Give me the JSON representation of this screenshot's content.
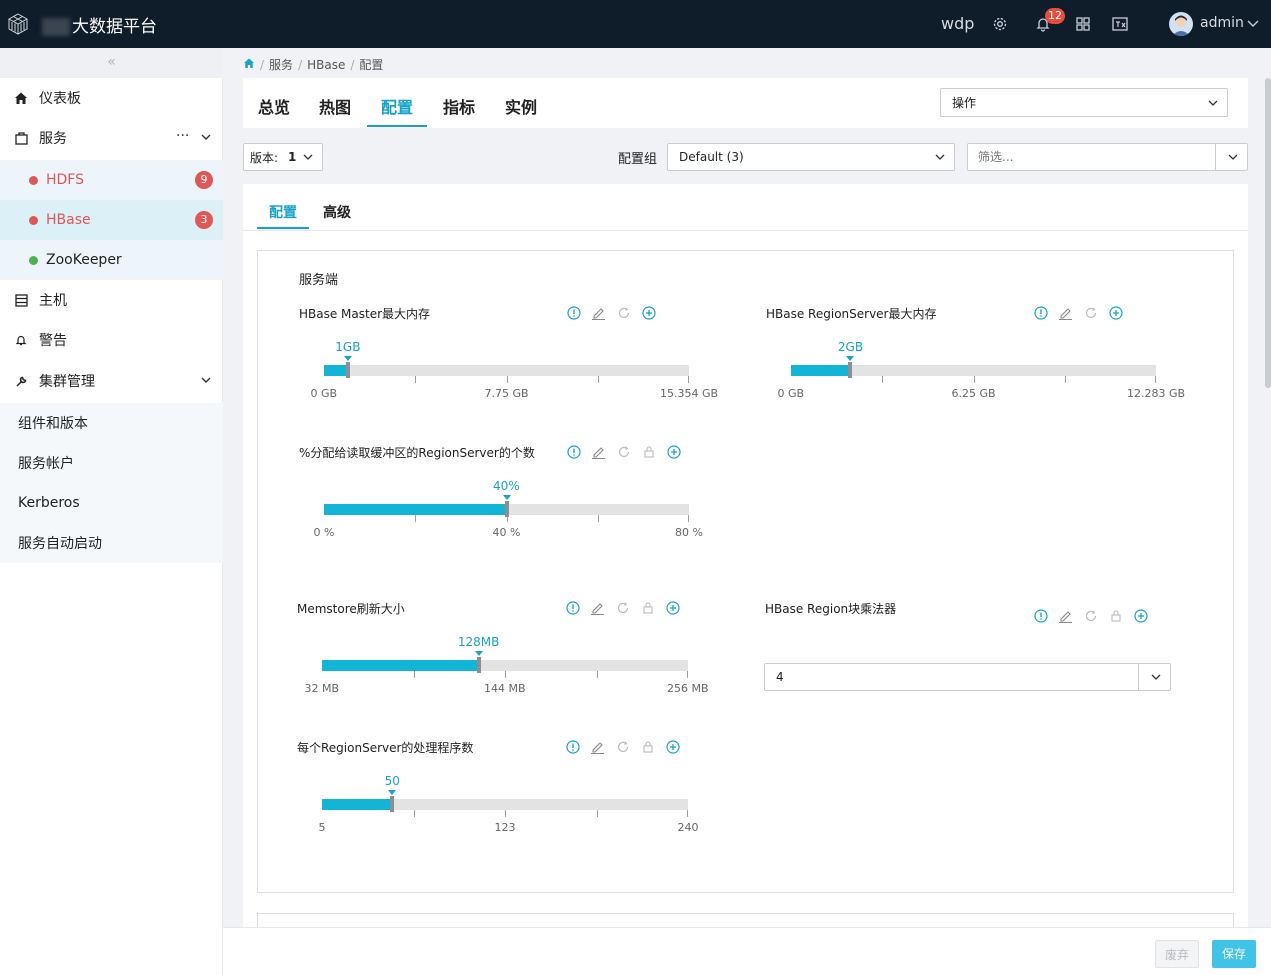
{
  "header": {
    "brand": "大数据平台",
    "brand_prefix": "",
    "user_short": "wdp",
    "notification_count": "12",
    "username": "admin"
  },
  "sidebar": {
    "collapse_label": "«",
    "items": [
      {
        "label": "仪表板"
      },
      {
        "label": "服务",
        "more": "···"
      },
      {
        "label": "主机"
      },
      {
        "label": "警告"
      },
      {
        "label": "集群管理"
      }
    ],
    "services": [
      {
        "label": "HDFS",
        "badge": "9",
        "color": "#e05757"
      },
      {
        "label": "HBase",
        "badge": "3",
        "color": "#e05757"
      },
      {
        "label": "ZooKeeper",
        "badge": "",
        "color": "#4caf50"
      }
    ],
    "cluster_items": [
      {
        "label": "组件和版本"
      },
      {
        "label": "服务帐户"
      },
      {
        "label": "Kerberos"
      },
      {
        "label": "服务自动启动"
      }
    ]
  },
  "breadcrumb": [
    "服务",
    "HBase",
    "配置"
  ],
  "tabs": [
    {
      "label": "总览"
    },
    {
      "label": "热图"
    },
    {
      "label": "配置",
      "active": true
    },
    {
      "label": "指标"
    },
    {
      "label": "实例"
    }
  ],
  "actions_select": "操作",
  "version": {
    "label": "版本:",
    "value": "1"
  },
  "config_group": {
    "label": "配置组",
    "value": "Default (3)"
  },
  "filter": {
    "placeholder": "筛选..."
  },
  "subtabs": [
    {
      "label": "配置",
      "active": true
    },
    {
      "label": "高级"
    }
  ],
  "section_title": "服务端",
  "fields": {
    "master_mem": {
      "label": "HBase Master最大内存",
      "value_label": "1GB",
      "value": 1,
      "min": 0,
      "max": 15.354,
      "axis": [
        "0 GB",
        "7.75 GB",
        "15.354 GB"
      ]
    },
    "rs_mem": {
      "label": "HBase RegionServer最大内存",
      "value_label": "2GB",
      "value": 2,
      "min": 0,
      "max": 12.283,
      "axis": [
        "0 GB",
        "6.25 GB",
        "12.283 GB"
      ]
    },
    "read_cache": {
      "label": "%分配给读取缓冲区的RegionServer的个数",
      "value_label": "40%",
      "value": 40,
      "min": 0,
      "max": 80,
      "axis": [
        "0 %",
        "40 %",
        "80 %"
      ]
    },
    "memstore": {
      "label": "Memstore刷新大小",
      "value_label": "128MB",
      "value": 128,
      "min": 32,
      "max": 256,
      "axis": [
        "32 MB",
        "144 MB",
        "256 MB"
      ]
    },
    "block_multiplier": {
      "label": "HBase Region块乘法器",
      "value": "4"
    },
    "handlers": {
      "label": "每个RegionServer的处理程序数",
      "value_label": "50",
      "value": 50,
      "min": 5,
      "max": 240,
      "axis": [
        "5",
        "123",
        "240"
      ]
    }
  },
  "footer": {
    "discard": "废弃",
    "save": "保存"
  },
  "colors": {
    "accent": "#17a2c8",
    "slider_fill": "#13b5d6",
    "alert": "#e05757",
    "ok": "#4caf50",
    "topbar": "#0f1c2a"
  }
}
